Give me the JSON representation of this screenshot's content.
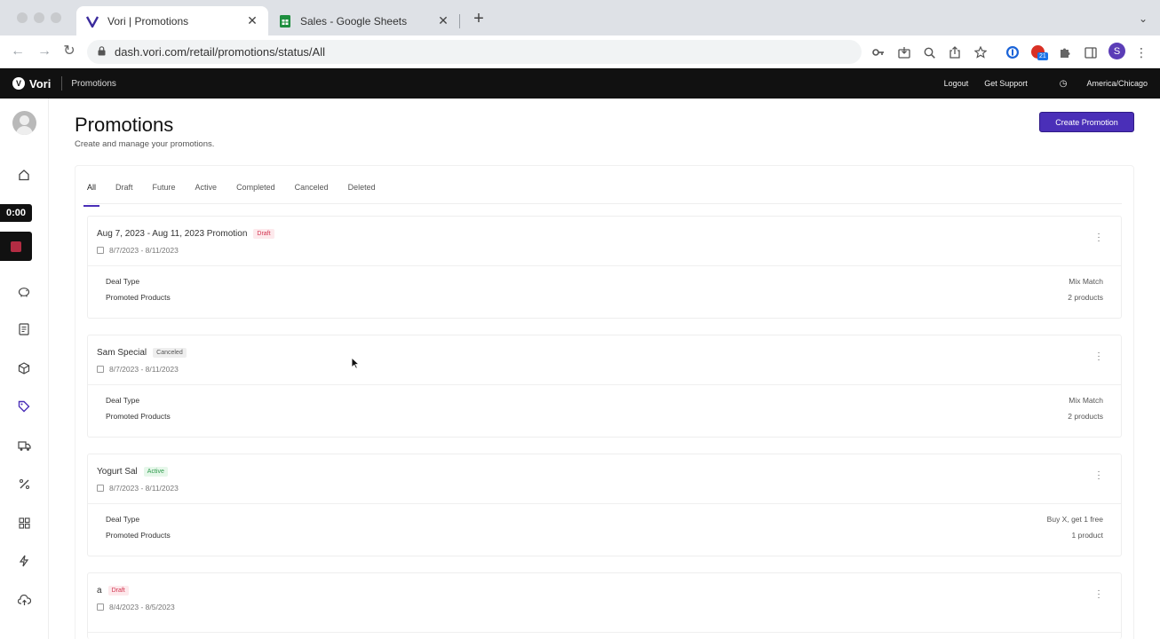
{
  "browser": {
    "tabs": [
      {
        "title": "Vori | Promotions",
        "active": true
      },
      {
        "title": "Sales - Google Sheets",
        "active": false
      }
    ],
    "url": "dash.vori.com/retail/promotions/status/All",
    "profile_initial": "S",
    "extension_badge": "21"
  },
  "appbar": {
    "brand": "Vori",
    "brand_initial": "V",
    "section": "Promotions",
    "logout": "Logout",
    "support": "Get Support",
    "timezone": "America/Chicago"
  },
  "recorder": {
    "time": "0:00"
  },
  "page": {
    "title": "Promotions",
    "subtitle": "Create and manage your promotions.",
    "create_button": "Create Promotion"
  },
  "filter_tabs": [
    "All",
    "Draft",
    "Future",
    "Active",
    "Completed",
    "Canceled",
    "Deleted"
  ],
  "labels": {
    "deal_type": "Deal Type",
    "promoted_products": "Promoted Products"
  },
  "promotions": [
    {
      "name": "Aug 7, 2023 - Aug 11, 2023 Promotion",
      "status": "Draft",
      "dates": "8/7/2023 - 8/11/2023",
      "deal_type": "Mix Match",
      "products": "2 products"
    },
    {
      "name": "Sam Special",
      "status": "Canceled",
      "dates": "8/7/2023 - 8/11/2023",
      "deal_type": "Mix Match",
      "products": "2 products"
    },
    {
      "name": "Yogurt Sal",
      "status": "Active",
      "dates": "8/7/2023 - 8/11/2023",
      "deal_type": "Buy X, get 1 free",
      "products": "1 product"
    },
    {
      "name": "a",
      "status": "Draft",
      "dates": "8/4/2023 - 8/5/2023"
    }
  ],
  "colors": {
    "accent": "#4a2fb8",
    "appbar": "#111111",
    "draft": "#d23550",
    "active": "#2e9a4c"
  }
}
